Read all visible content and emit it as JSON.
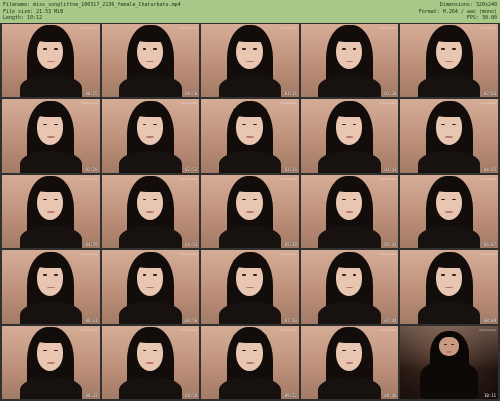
{
  "header": {
    "filename_line": "Filename: miss_songlittne_100317_2136_female_Chaturbate.mp4",
    "filesize_line": "File size: 21.53 MiB",
    "length_line": "Length: 10:12",
    "dimensions_line": "Dimensions: 320x240",
    "format_line": "Format: H.264 / aac (mono)",
    "fps_line": "FPS: 30.00"
  },
  "colors": {
    "header_bg": "#a9c98a",
    "page_bg": "#303030"
  },
  "watermark": "Chaturbate",
  "thumbnails": [
    {
      "timestamp": "00:25",
      "variant": "light"
    },
    {
      "timestamp": "00:50",
      "variant": "light"
    },
    {
      "timestamp": "01:14",
      "variant": "light"
    },
    {
      "timestamp": "01:38",
      "variant": "light"
    },
    {
      "timestamp": "02:03",
      "variant": "light"
    },
    {
      "timestamp": "02:28",
      "variant": "light"
    },
    {
      "timestamp": "02:52",
      "variant": "light"
    },
    {
      "timestamp": "03:16",
      "variant": "light"
    },
    {
      "timestamp": "03:41",
      "variant": "light"
    },
    {
      "timestamp": "04:05",
      "variant": "light"
    },
    {
      "timestamp": "04:29",
      "variant": "light"
    },
    {
      "timestamp": "04:54",
      "variant": "light"
    },
    {
      "timestamp": "05:18",
      "variant": "light"
    },
    {
      "timestamp": "05:43",
      "variant": "light"
    },
    {
      "timestamp": "06:07",
      "variant": "light"
    },
    {
      "timestamp": "06:31",
      "variant": "light"
    },
    {
      "timestamp": "06:56",
      "variant": "light"
    },
    {
      "timestamp": "07:20",
      "variant": "light"
    },
    {
      "timestamp": "07:44",
      "variant": "light"
    },
    {
      "timestamp": "08:09",
      "variant": "light"
    },
    {
      "timestamp": "08:33",
      "variant": "light"
    },
    {
      "timestamp": "08:58",
      "variant": "light"
    },
    {
      "timestamp": "09:22",
      "variant": "light"
    },
    {
      "timestamp": "09:46",
      "variant": "light"
    },
    {
      "timestamp": "10:11",
      "variant": "dark"
    }
  ]
}
